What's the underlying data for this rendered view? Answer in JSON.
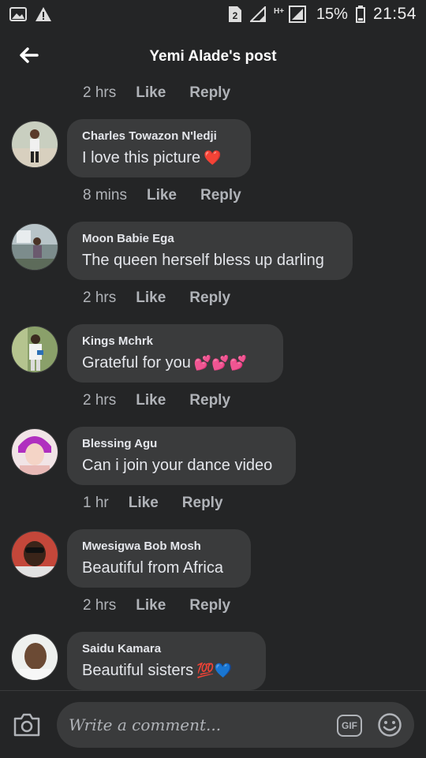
{
  "status_bar": {
    "sim_badge": "2",
    "network": "H+",
    "battery_pct": "15%",
    "time": "21:54"
  },
  "header": {
    "title": "Yemi Alade's post"
  },
  "top_meta": {
    "time": "2 hrs",
    "like": "Like",
    "reply": "Reply"
  },
  "comments": [
    {
      "author": "Charles Towazon N'ledji",
      "text": "I love this picture",
      "emoji": "❤️",
      "time": "8 mins",
      "like": "Like",
      "reply": "Reply"
    },
    {
      "author": "Moon Babie Ega",
      "text": "The queen herself bless up darling",
      "emoji": "",
      "time": "2 hrs",
      "like": "Like",
      "reply": "Reply"
    },
    {
      "author": "Kings Mchrk",
      "text": "Grateful for you",
      "emoji": "💕💕💕",
      "time": "2 hrs",
      "like": "Like",
      "reply": "Reply"
    },
    {
      "author": "Blessing Agu",
      "text": "Can i join your dance video",
      "emoji": "",
      "time": "1 hr",
      "like": "Like",
      "reply": "Reply"
    },
    {
      "author": "Mwesigwa Bob Mosh",
      "text": "Beautiful from Africa",
      "emoji": "",
      "time": "2 hrs",
      "like": "Like",
      "reply": "Reply"
    },
    {
      "author": "Saidu Kamara",
      "text": "Beautiful sisters",
      "emoji": "💯💙",
      "time": "",
      "like": "",
      "reply": ""
    }
  ],
  "composer": {
    "placeholder": "Write a comment...",
    "gif_label": "GIF"
  },
  "icons": {
    "back": "arrow-left-icon",
    "camera": "camera-icon",
    "gif": "gif-icon",
    "emoji": "smiley-icon"
  },
  "colors": {
    "background": "#242526",
    "bubble": "#3a3b3c",
    "text": "#e4e6eb",
    "secondary": "#b0b3b8"
  }
}
